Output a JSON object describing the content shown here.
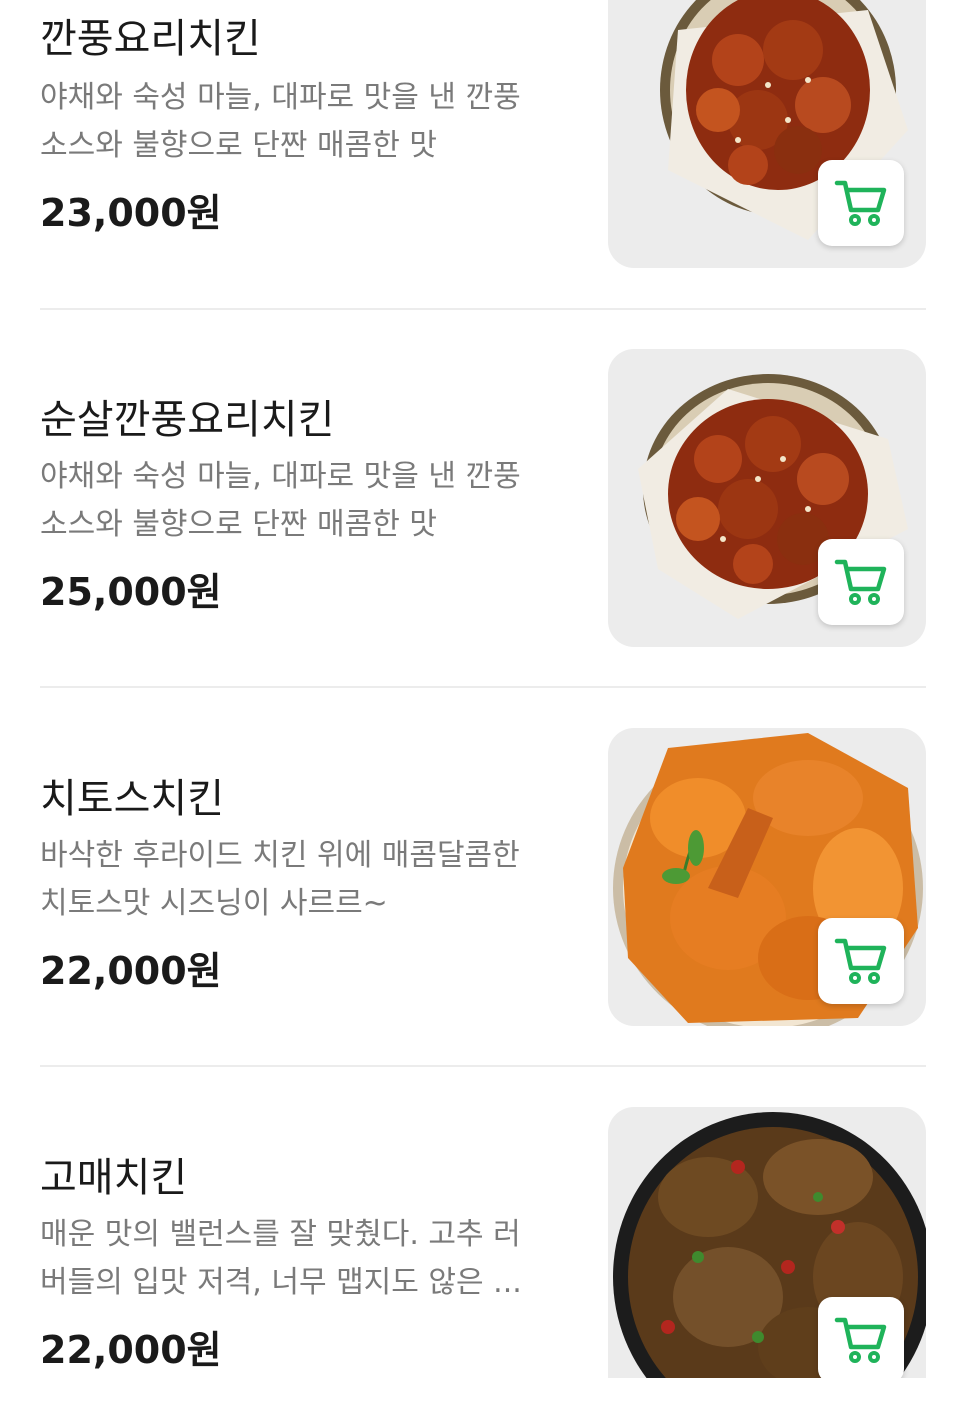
{
  "menu": {
    "items": [
      {
        "name": "깐풍요리치킨",
        "desc_line1": "야채와 숙성 마늘, 대파로 맛을 낸 깐풍",
        "desc_line2": "소스와 불향으로 단짠 매콤한 맛",
        "price": "23,000원",
        "image": "kkanpung-chicken-on-plate",
        "cart_icon": "cart-icon"
      },
      {
        "name": "순살깐풍요리치킨",
        "desc_line1": "야채와 숙성 마늘, 대파로 맛을 낸 깐풍",
        "desc_line2": "소스와 불향으로 단짠 매콤한 맛",
        "price": "25,000원",
        "image": "boneless-kkanpung-chicken-on-plate",
        "cart_icon": "cart-icon"
      },
      {
        "name": "치토스치킨",
        "desc_line1": "바삭한 후라이드 치킨 위에 매콤달콤한",
        "desc_line2": "치토스맛 시즈닝이 사르르~",
        "price": "22,000원",
        "image": "cheetos-fried-chicken",
        "cart_icon": "cart-icon"
      },
      {
        "name": "고매치킨",
        "desc_line1": "매운 맛의 밸런스를 잘 맞췄다. 고추 러",
        "desc_line2": "버들의 입맛 저격, 너무 맵지도 않은 ...",
        "price": "22,000원",
        "image": "gomae-chicken-with-peppers",
        "cart_icon": "cart-icon"
      }
    ]
  },
  "colors": {
    "accent_green": "#1fb35a",
    "text_primary": "#1a1a1a",
    "text_secondary": "#7a7a7a",
    "thumb_bg": "#ececec"
  }
}
